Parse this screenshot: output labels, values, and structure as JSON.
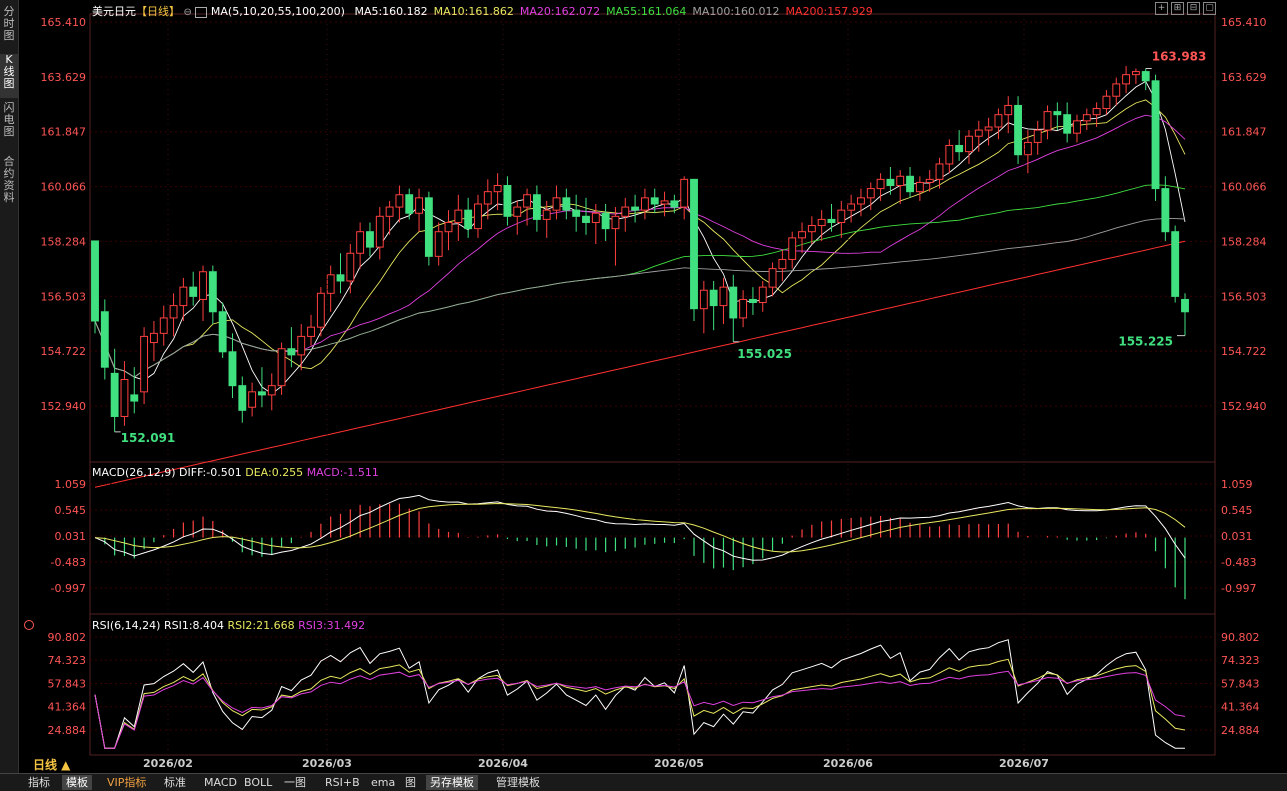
{
  "sidebar": {
    "tabs": [
      {
        "label": "分时图",
        "active": false
      },
      {
        "label": "K线图",
        "active": true
      },
      {
        "label": "闪电图",
        "active": false
      },
      {
        "label": "合约资料",
        "active": false
      }
    ]
  },
  "header": {
    "symbol": "美元日元",
    "period_tag": "【日线】",
    "ma_params": "MA(5,10,20,55,100,200)",
    "ma_values": [
      {
        "label": "MA5:160.182",
        "color": "#ffffff"
      },
      {
        "label": "MA10:161.862",
        "color": "#e8e860"
      },
      {
        "label": "MA20:162.072",
        "color": "#e040e0"
      },
      {
        "label": "MA55:161.064",
        "color": "#40e040"
      },
      {
        "label": "MA100:160.012",
        "color": "#a0a0a0"
      },
      {
        "label": "MA200:157.929",
        "color": "#ff3030"
      }
    ]
  },
  "macd": {
    "title": "MACD(26,12,9)",
    "diff": "DIFF:-0.501",
    "dea": "DEA:0.255",
    "macd": "MACD:-1.511"
  },
  "rsi": {
    "title": "RSI(6,14,24)",
    "rsi1": "RSI1:8.404",
    "rsi2": "RSI2:21.668",
    "rsi3": "RSI3:31.492"
  },
  "bottom_bar": {
    "period": "日线 ▲",
    "tabs": [
      "指标",
      "模板",
      "VIP指标",
      "标准",
      "MACD",
      "BOLL",
      "一图",
      "RSI+B",
      "ema",
      "图",
      "另存模板",
      "管理模板"
    ]
  },
  "colors": {
    "up": "#ff4040",
    "down": "#40e080",
    "price_axis": "#ff5555",
    "grid": "#3a0000"
  },
  "chart_data": [
    {
      "type": "candlestick",
      "title": "美元日元 日线",
      "y_ticks": [
        "165.410",
        "163.629",
        "161.847",
        "160.066",
        "158.284",
        "156.503",
        "154.722",
        "152.940"
      ],
      "ylim": [
        151.6,
        165.41
      ],
      "x_ticks": [
        "2026/02",
        "2026/03",
        "2026/04",
        "2026/05",
        "2026/06",
        "2026/07"
      ],
      "annotations": [
        {
          "text": "163.983",
          "kind": "high"
        },
        {
          "text": "155.025",
          "kind": "low"
        },
        {
          "text": "152.091",
          "kind": "low"
        },
        {
          "text": "155.225",
          "kind": "low"
        }
      ],
      "candles": [
        {
          "o": 158.3,
          "h": 158.2,
          "l": 155.3,
          "c": 155.7
        },
        {
          "o": 156.0,
          "h": 156.4,
          "l": 153.8,
          "c": 154.2
        },
        {
          "o": 154.0,
          "h": 154.8,
          "l": 152.1,
          "c": 152.6
        },
        {
          "o": 152.6,
          "h": 154.4,
          "l": 152.3,
          "c": 153.8
        },
        {
          "o": 153.3,
          "h": 154.2,
          "l": 152.7,
          "c": 153.1
        },
        {
          "o": 153.4,
          "h": 155.5,
          "l": 153.0,
          "c": 155.2
        },
        {
          "o": 155.0,
          "h": 155.7,
          "l": 154.4,
          "c": 155.3
        },
        {
          "o": 155.3,
          "h": 156.2,
          "l": 154.9,
          "c": 155.8
        },
        {
          "o": 155.8,
          "h": 156.6,
          "l": 155.2,
          "c": 156.2
        },
        {
          "o": 156.2,
          "h": 157.1,
          "l": 155.7,
          "c": 156.8
        },
        {
          "o": 156.8,
          "h": 157.3,
          "l": 156.2,
          "c": 156.5
        },
        {
          "o": 156.4,
          "h": 157.5,
          "l": 155.7,
          "c": 157.3
        },
        {
          "o": 157.3,
          "h": 157.5,
          "l": 155.6,
          "c": 156.0
        },
        {
          "o": 156.0,
          "h": 156.3,
          "l": 154.5,
          "c": 154.7
        },
        {
          "o": 154.7,
          "h": 155.3,
          "l": 153.2,
          "c": 153.6
        },
        {
          "o": 153.6,
          "h": 153.9,
          "l": 152.4,
          "c": 152.8
        },
        {
          "o": 152.9,
          "h": 153.7,
          "l": 152.6,
          "c": 153.4
        },
        {
          "o": 153.4,
          "h": 154.2,
          "l": 152.9,
          "c": 153.3
        },
        {
          "o": 153.3,
          "h": 154.0,
          "l": 152.8,
          "c": 153.6
        },
        {
          "o": 153.6,
          "h": 155.0,
          "l": 153.3,
          "c": 154.8
        },
        {
          "o": 154.8,
          "h": 155.5,
          "l": 154.2,
          "c": 154.6
        },
        {
          "o": 154.6,
          "h": 155.6,
          "l": 154.1,
          "c": 155.2
        },
        {
          "o": 155.2,
          "h": 155.9,
          "l": 154.9,
          "c": 155.5
        },
        {
          "o": 155.5,
          "h": 156.8,
          "l": 155.2,
          "c": 156.6
        },
        {
          "o": 156.6,
          "h": 157.5,
          "l": 156.0,
          "c": 157.2
        },
        {
          "o": 157.2,
          "h": 157.9,
          "l": 156.6,
          "c": 157.0
        },
        {
          "o": 157.0,
          "h": 158.2,
          "l": 156.6,
          "c": 157.9
        },
        {
          "o": 157.9,
          "h": 158.9,
          "l": 157.4,
          "c": 158.6
        },
        {
          "o": 158.6,
          "h": 158.9,
          "l": 157.8,
          "c": 158.1
        },
        {
          "o": 158.1,
          "h": 159.4,
          "l": 157.7,
          "c": 159.1
        },
        {
          "o": 159.1,
          "h": 159.6,
          "l": 158.5,
          "c": 159.4
        },
        {
          "o": 159.4,
          "h": 160.1,
          "l": 158.9,
          "c": 159.8
        },
        {
          "o": 159.8,
          "h": 160.0,
          "l": 159.0,
          "c": 159.2
        },
        {
          "o": 159.2,
          "h": 160.0,
          "l": 158.6,
          "c": 159.7
        },
        {
          "o": 159.7,
          "h": 159.9,
          "l": 157.5,
          "c": 157.8
        },
        {
          "o": 157.8,
          "h": 158.9,
          "l": 157.5,
          "c": 158.6
        },
        {
          "o": 158.6,
          "h": 159.3,
          "l": 158.0,
          "c": 158.9
        },
        {
          "o": 158.9,
          "h": 159.8,
          "l": 158.3,
          "c": 159.3
        },
        {
          "o": 159.3,
          "h": 159.7,
          "l": 158.4,
          "c": 158.7
        },
        {
          "o": 158.7,
          "h": 159.8,
          "l": 158.4,
          "c": 159.5
        },
        {
          "o": 159.5,
          "h": 160.3,
          "l": 159.0,
          "c": 159.9
        },
        {
          "o": 159.9,
          "h": 160.5,
          "l": 159.3,
          "c": 160.1
        },
        {
          "o": 160.1,
          "h": 160.4,
          "l": 158.8,
          "c": 159.1
        },
        {
          "o": 159.1,
          "h": 159.6,
          "l": 158.5,
          "c": 159.4
        },
        {
          "o": 159.4,
          "h": 160.0,
          "l": 158.8,
          "c": 159.8
        },
        {
          "o": 159.8,
          "h": 160.1,
          "l": 158.6,
          "c": 159.0
        },
        {
          "o": 159.0,
          "h": 159.6,
          "l": 158.4,
          "c": 159.3
        },
        {
          "o": 159.3,
          "h": 160.1,
          "l": 159.0,
          "c": 159.7
        },
        {
          "o": 159.7,
          "h": 160.0,
          "l": 159.0,
          "c": 159.3
        },
        {
          "o": 159.3,
          "h": 159.8,
          "l": 158.6,
          "c": 159.1
        },
        {
          "o": 159.1,
          "h": 159.7,
          "l": 158.5,
          "c": 158.9
        },
        {
          "o": 158.9,
          "h": 159.5,
          "l": 158.2,
          "c": 159.2
        },
        {
          "o": 159.2,
          "h": 159.5,
          "l": 158.3,
          "c": 158.7
        },
        {
          "o": 158.7,
          "h": 159.4,
          "l": 157.5,
          "c": 159.1
        },
        {
          "o": 159.1,
          "h": 159.7,
          "l": 158.6,
          "c": 159.4
        },
        {
          "o": 159.4,
          "h": 159.8,
          "l": 158.9,
          "c": 159.3
        },
        {
          "o": 159.3,
          "h": 160.0,
          "l": 159.0,
          "c": 159.7
        },
        {
          "o": 159.7,
          "h": 160.0,
          "l": 159.2,
          "c": 159.5
        },
        {
          "o": 159.5,
          "h": 159.9,
          "l": 159.1,
          "c": 159.6
        },
        {
          "o": 159.6,
          "h": 159.8,
          "l": 159.2,
          "c": 159.4
        },
        {
          "o": 159.4,
          "h": 160.4,
          "l": 159.0,
          "c": 160.3
        },
        {
          "o": 160.3,
          "h": 160.3,
          "l": 155.7,
          "c": 156.1
        },
        {
          "o": 156.1,
          "h": 157.0,
          "l": 155.3,
          "c": 156.7
        },
        {
          "o": 156.7,
          "h": 157.0,
          "l": 155.4,
          "c": 156.2
        },
        {
          "o": 156.2,
          "h": 157.1,
          "l": 155.6,
          "c": 156.8
        },
        {
          "o": 156.8,
          "h": 157.2,
          "l": 155.025,
          "c": 155.8
        },
        {
          "o": 155.8,
          "h": 156.7,
          "l": 155.5,
          "c": 156.4
        },
        {
          "o": 156.4,
          "h": 156.8,
          "l": 155.9,
          "c": 156.3
        },
        {
          "o": 156.3,
          "h": 157.0,
          "l": 156.0,
          "c": 156.8
        },
        {
          "o": 156.8,
          "h": 157.6,
          "l": 156.5,
          "c": 157.4
        },
        {
          "o": 157.4,
          "h": 158.0,
          "l": 157.0,
          "c": 157.7
        },
        {
          "o": 157.7,
          "h": 158.6,
          "l": 157.4,
          "c": 158.4
        },
        {
          "o": 158.4,
          "h": 158.9,
          "l": 157.9,
          "c": 158.6
        },
        {
          "o": 158.6,
          "h": 159.1,
          "l": 158.2,
          "c": 158.8
        },
        {
          "o": 158.8,
          "h": 159.3,
          "l": 158.3,
          "c": 159.0
        },
        {
          "o": 159.0,
          "h": 159.5,
          "l": 158.6,
          "c": 158.9
        },
        {
          "o": 158.9,
          "h": 159.6,
          "l": 158.4,
          "c": 159.3
        },
        {
          "o": 159.3,
          "h": 159.8,
          "l": 158.9,
          "c": 159.5
        },
        {
          "o": 159.5,
          "h": 160.0,
          "l": 159.1,
          "c": 159.7
        },
        {
          "o": 159.7,
          "h": 160.2,
          "l": 159.3,
          "c": 160.0
        },
        {
          "o": 160.0,
          "h": 160.5,
          "l": 159.6,
          "c": 160.3
        },
        {
          "o": 160.3,
          "h": 160.7,
          "l": 159.8,
          "c": 160.1
        },
        {
          "o": 160.1,
          "h": 160.6,
          "l": 159.5,
          "c": 160.4
        },
        {
          "o": 160.4,
          "h": 160.7,
          "l": 159.7,
          "c": 159.9
        },
        {
          "o": 159.9,
          "h": 160.4,
          "l": 159.6,
          "c": 160.2
        },
        {
          "o": 160.2,
          "h": 160.6,
          "l": 159.9,
          "c": 160.3
        },
        {
          "o": 160.3,
          "h": 161.0,
          "l": 160.0,
          "c": 160.8
        },
        {
          "o": 160.8,
          "h": 161.6,
          "l": 160.5,
          "c": 161.4
        },
        {
          "o": 161.4,
          "h": 161.9,
          "l": 160.9,
          "c": 161.2
        },
        {
          "o": 161.2,
          "h": 161.9,
          "l": 160.8,
          "c": 161.7
        },
        {
          "o": 161.7,
          "h": 162.2,
          "l": 161.2,
          "c": 161.9
        },
        {
          "o": 161.9,
          "h": 162.3,
          "l": 161.4,
          "c": 162.0
        },
        {
          "o": 162.0,
          "h": 162.6,
          "l": 161.6,
          "c": 162.4
        },
        {
          "o": 162.4,
          "h": 163.0,
          "l": 161.8,
          "c": 162.7
        },
        {
          "o": 162.7,
          "h": 163.0,
          "l": 160.8,
          "c": 161.1
        },
        {
          "o": 161.1,
          "h": 161.9,
          "l": 160.5,
          "c": 161.5
        },
        {
          "o": 161.5,
          "h": 162.2,
          "l": 161.1,
          "c": 161.9
        },
        {
          "o": 161.9,
          "h": 162.7,
          "l": 161.6,
          "c": 162.5
        },
        {
          "o": 162.5,
          "h": 162.8,
          "l": 161.9,
          "c": 162.4
        },
        {
          "o": 162.4,
          "h": 162.8,
          "l": 161.5,
          "c": 161.8
        },
        {
          "o": 161.8,
          "h": 162.4,
          "l": 161.5,
          "c": 162.2
        },
        {
          "o": 162.2,
          "h": 162.6,
          "l": 161.9,
          "c": 162.4
        },
        {
          "o": 162.4,
          "h": 162.8,
          "l": 162.0,
          "c": 162.6
        },
        {
          "o": 162.6,
          "h": 163.2,
          "l": 162.4,
          "c": 163.0
        },
        {
          "o": 163.0,
          "h": 163.6,
          "l": 162.7,
          "c": 163.4
        },
        {
          "o": 163.4,
          "h": 163.983,
          "l": 163.1,
          "c": 163.7
        },
        {
          "o": 163.7,
          "h": 163.9,
          "l": 163.4,
          "c": 163.8
        },
        {
          "o": 163.8,
          "h": 163.9,
          "l": 163.2,
          "c": 163.5
        },
        {
          "o": 163.5,
          "h": 163.7,
          "l": 159.6,
          "c": 160.0
        },
        {
          "o": 160.0,
          "h": 160.4,
          "l": 158.3,
          "c": 158.6
        },
        {
          "o": 158.6,
          "h": 158.8,
          "l": 156.3,
          "c": 156.5
        },
        {
          "o": 156.4,
          "h": 156.6,
          "l": 155.225,
          "c": 156.0
        }
      ]
    },
    {
      "type": "bar",
      "title": "MACD(26,12,9)",
      "y_ticks": [
        "1.059",
        "0.545",
        "0.031",
        "-0.483",
        "-0.997"
      ],
      "ylim": [
        -1.45,
        1.27
      ],
      "series": [
        {
          "name": "DIFF",
          "color": "#ffffff"
        },
        {
          "name": "DEA",
          "color": "#e8e860"
        },
        {
          "name": "MACD",
          "color": "#ff4040"
        }
      ]
    },
    {
      "type": "line",
      "title": "RSI(6,14,24)",
      "y_ticks": [
        "90.802",
        "74.323",
        "57.843",
        "41.364",
        "24.884"
      ],
      "ylim": [
        10,
        100
      ],
      "series": [
        {
          "name": "RSI1",
          "color": "#ffffff"
        },
        {
          "name": "RSI2",
          "color": "#e8e860"
        },
        {
          "name": "RSI3",
          "color": "#e040e0"
        }
      ]
    }
  ]
}
